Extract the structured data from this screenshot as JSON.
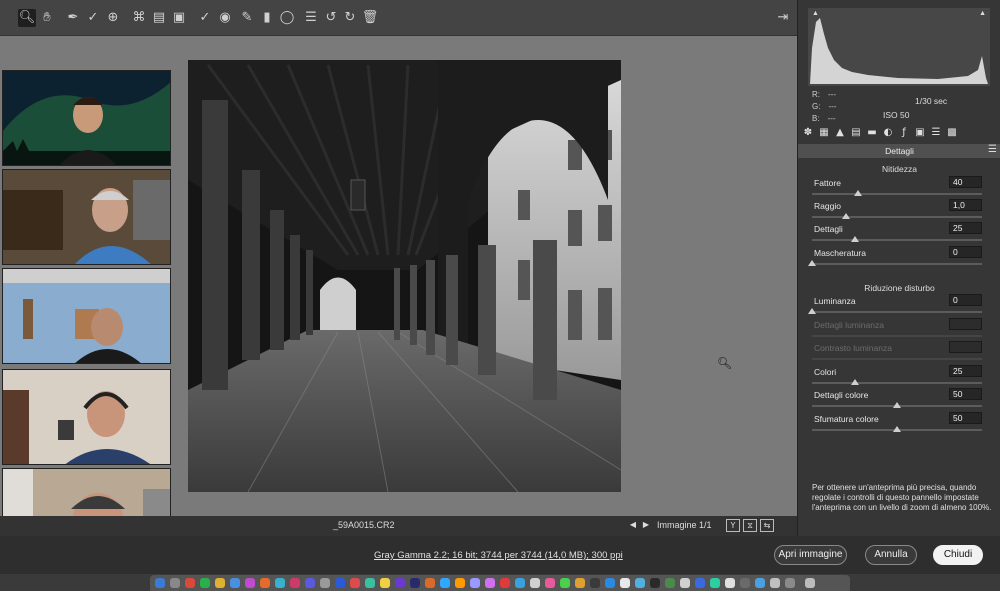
{
  "toolbar": {
    "tools": [
      "zoom-tool",
      "hand-tool",
      "white-balance-tool",
      "color-sampler-tool",
      "targeted-adjustment-tool",
      "crop-tool",
      "straighten-tool",
      "transform-tool",
      "spot-removal-tool",
      "red-eye-tool",
      "adjustment-brush-tool",
      "graduated-filter-tool",
      "radial-filter-tool",
      "preferences-tool",
      "rotate-ccw-tool",
      "rotate-cw-tool",
      "trash-tool"
    ]
  },
  "histogram": {
    "r_label": "R:",
    "g_label": "G:",
    "b_label": "B:",
    "r_value": "---",
    "g_value": "---",
    "b_value": "---",
    "shutter": "1/30 sec",
    "iso": "ISO 50"
  },
  "panel": {
    "title": "Dettagli",
    "sharpening_title": "Nitidezza",
    "noise_title": "Riduzione disturbo",
    "sliders": [
      {
        "label": "Fattore",
        "value": "40",
        "pos": 0.27,
        "disabled": false
      },
      {
        "label": "Raggio",
        "value": "1,0",
        "pos": 0.2,
        "disabled": false
      },
      {
        "label": "Dettagli",
        "value": "25",
        "pos": 0.25,
        "disabled": false
      },
      {
        "label": "Mascheratura",
        "value": "0",
        "pos": 0.0,
        "disabled": false
      },
      {
        "label": "Luminanza",
        "value": "0",
        "pos": 0.0,
        "disabled": false
      },
      {
        "label": "Dettagli luminanza",
        "value": "",
        "pos": null,
        "disabled": true
      },
      {
        "label": "Contrasto luminanza",
        "value": "",
        "pos": null,
        "disabled": true
      },
      {
        "label": "Colori",
        "value": "25",
        "pos": 0.25,
        "disabled": false
      },
      {
        "label": "Dettagli colore",
        "value": "50",
        "pos": 0.5,
        "disabled": false
      },
      {
        "label": "Sfumatura colore",
        "value": "50",
        "pos": 0.5,
        "disabled": false
      }
    ],
    "note": "Per ottenere un'anteprima più precisa, quando regolate i controlli di questo pannello impostate l'anteprima con un livello di zoom di almeno 100%."
  },
  "status": {
    "filename": "_59A0015.CR2",
    "image_count": "Immagine 1/1",
    "view_btn_1": "Y",
    "view_btn_2": "⧖",
    "view_btn_3": "⇆"
  },
  "bottom": {
    "workflow": "Gray Gamma 2.2; 16 bit; 3744 per 3744 (14,0 MB); 300 ppi",
    "open": "Apri immagine",
    "cancel": "Annulla",
    "done": "Chiudi"
  },
  "colors": {
    "panel_bg": "#363636",
    "canvas_bg": "#7a7a7a",
    "accent": "#f2f2f2"
  }
}
